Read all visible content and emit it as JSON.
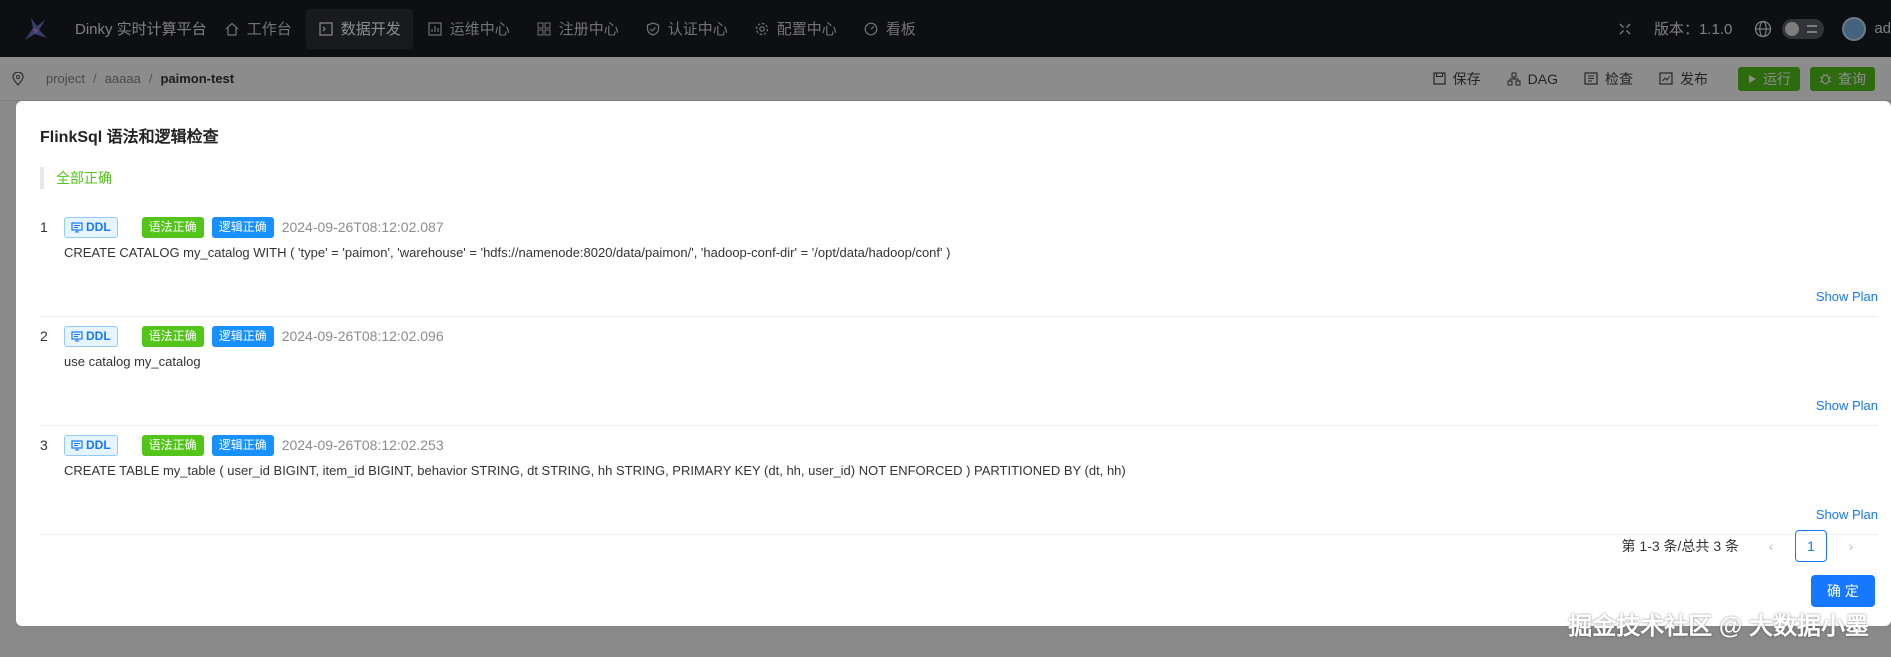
{
  "app": {
    "title": "Dinky 实时计算平台"
  },
  "nav": [
    {
      "label": "工作台",
      "icon": "home-icon"
    },
    {
      "label": "数据开发",
      "icon": "code-icon",
      "active": true
    },
    {
      "label": "运维中心",
      "icon": "chart-icon"
    },
    {
      "label": "注册中心",
      "icon": "grid-icon"
    },
    {
      "label": "认证中心",
      "icon": "shield-icon"
    },
    {
      "label": "配置中心",
      "icon": "gear-icon"
    },
    {
      "label": "看板",
      "icon": "dashboard-icon"
    }
  ],
  "header_right": {
    "version_label": "版本：1.1.0",
    "user_name": "ad"
  },
  "breadcrumb": [
    "project",
    "aaaaa",
    "paimon-test"
  ],
  "toolbar": {
    "save": "保存",
    "dag": "DAG",
    "check": "检查",
    "publish": "发布",
    "run": "运行",
    "query": "查询"
  },
  "modal": {
    "title": "FlinkSql 语法和逻辑检查",
    "status": "全部正确",
    "items": [
      {
        "index": "1",
        "type": "DDL",
        "syntax": "语法正确",
        "logic": "逻辑正确",
        "time": "2024-09-26T08:12:02.087",
        "sql": "CREATE CATALOG my_catalog WITH ( 'type' = 'paimon', 'warehouse' = 'hdfs://namenode:8020/data/paimon/', 'hadoop-conf-dir' = '/opt/data/hadoop/conf' )",
        "plan": "Show Plan"
      },
      {
        "index": "2",
        "type": "DDL",
        "syntax": "语法正确",
        "logic": "逻辑正确",
        "time": "2024-09-26T08:12:02.096",
        "sql": "use catalog my_catalog",
        "plan": "Show Plan"
      },
      {
        "index": "3",
        "type": "DDL",
        "syntax": "语法正确",
        "logic": "逻辑正确",
        "time": "2024-09-26T08:12:02.253",
        "sql": "CREATE TABLE my_table ( user_id BIGINT, item_id BIGINT, behavior STRING, dt STRING, hh STRING, PRIMARY KEY (dt, hh, user_id) NOT ENFORCED ) PARTITIONED BY (dt, hh)",
        "plan": "Show Plan"
      }
    ],
    "pagination": {
      "total_text": "第 1-3 条/总共 3 条",
      "current_page": "1"
    },
    "ok_label": "确 定"
  },
  "watermark": "掘金技术社区 @ 大数据小墨",
  "colors": {
    "topbar": "#1b1d21",
    "success": "#52c41a",
    "primary": "#1677ff"
  }
}
